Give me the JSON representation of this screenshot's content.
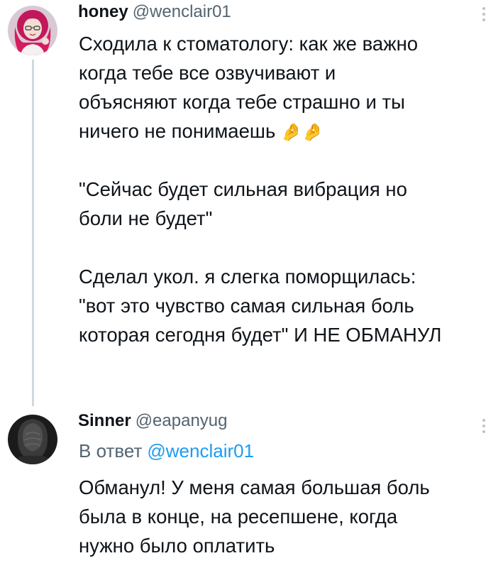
{
  "tweets": [
    {
      "display_name": "honey",
      "handle": "@wenclair01",
      "avatar_icon": "avatar-pink-hair-girl",
      "emoji_pair": "🤌🤌",
      "text_part1": "Сходила к стоматологу: как же важно\nкогда тебе все озвучивают и\nобъясняют когда тебе страшно и ты\nничего не понимаешь ",
      "text_part2": "\n\n\"Сейчас будет сильная вибрация но\nболи не будет\"\n\nСделал укол. я слегка поморщилась:\n\"вот это чувство самая сильная боль\nкоторая сегодня будет\" И НЕ ОБМАНУЛ"
    },
    {
      "display_name": "Sinner",
      "handle": "@eapanyug",
      "avatar_icon": "avatar-dark-hooded-figure",
      "reply_prefix": "В ответ",
      "reply_mention": "@wenclair01",
      "text": "Обманул! У меня самая большая боль\nбыла в конце, на ресепшене, когда\nнужно было оплатить"
    }
  ],
  "colors": {
    "text_primary": "#0f1419",
    "text_secondary": "#536471",
    "link": "#1d9bf0",
    "thread_line": "#cfd9de"
  }
}
